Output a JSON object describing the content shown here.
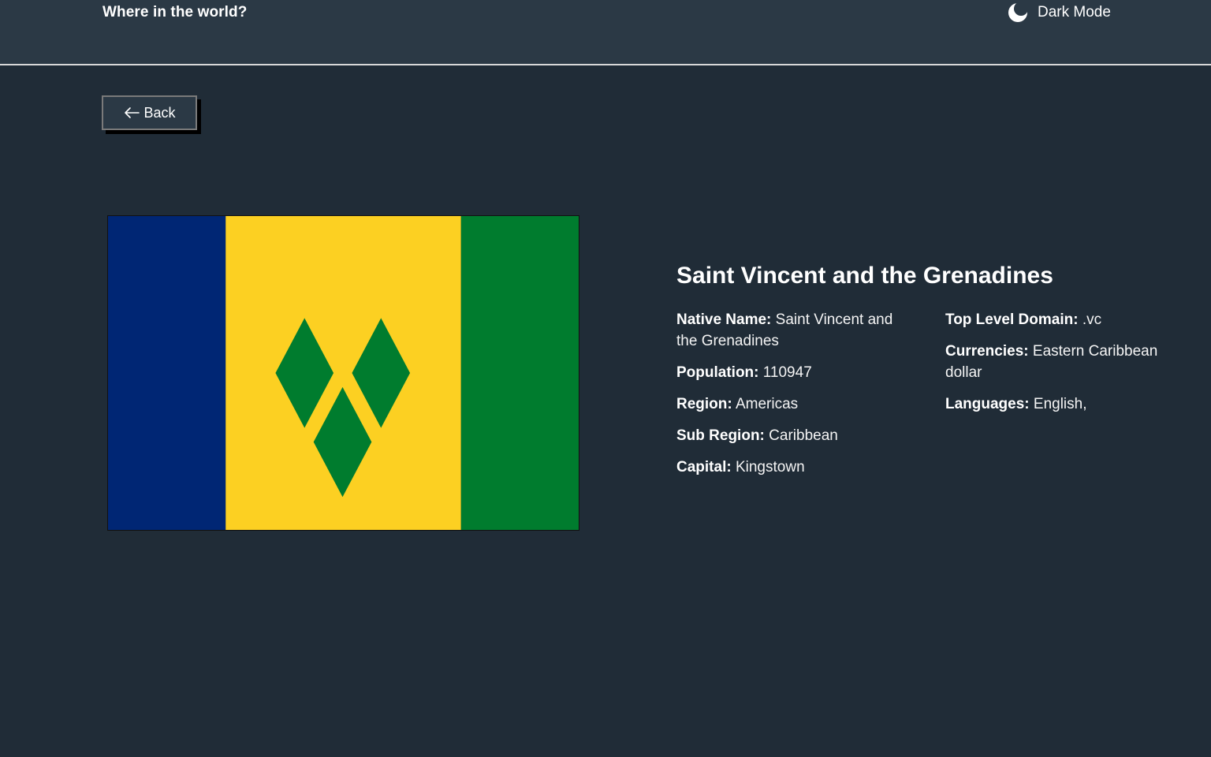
{
  "header": {
    "title": "Where in the world?",
    "dark_mode_label": "Dark Mode",
    "icon": "moon-icon"
  },
  "back_button": {
    "label": "Back",
    "icon": "arrow-left-icon"
  },
  "flag": {
    "country": "Saint Vincent and the Grenadines",
    "colors": {
      "blue": "#002674",
      "yellow": "#fcd022",
      "green": "#007c2e"
    }
  },
  "country": {
    "name": "Saint Vincent and the Grenadines",
    "native_name": {
      "label": "Native Name:",
      "value": "Saint Vincent and the Grenadines"
    },
    "population": {
      "label": "Population:",
      "value": "110947"
    },
    "region": {
      "label": "Region:",
      "value": "Americas"
    },
    "sub_region": {
      "label": "Sub Region:",
      "value": "Caribbean"
    },
    "capital": {
      "label": "Capital:",
      "value": "Kingstown"
    },
    "top_level_domain": {
      "label": "Top Level Domain:",
      "value": ".vc"
    },
    "currencies": {
      "label": "Currencies:",
      "value": "Eastern Caribbean dollar"
    },
    "languages": {
      "label": "Languages:",
      "value": "English,"
    }
  },
  "theme": {
    "background": "#202c37",
    "elements": "#2b3945",
    "text": "#ffffff"
  }
}
